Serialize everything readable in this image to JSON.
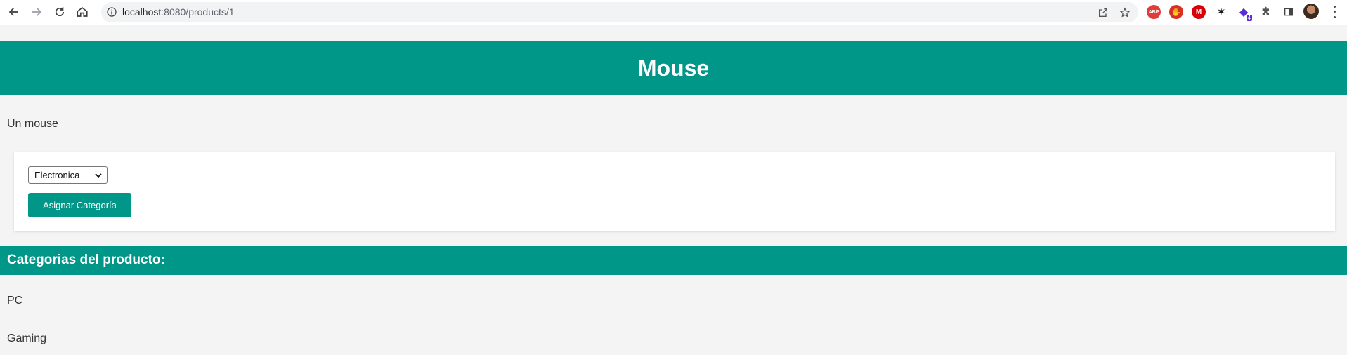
{
  "browser": {
    "url_host": "localhost",
    "url_path": ":8080/products/1",
    "icons": {
      "back": "arrow-left-icon",
      "forward": "arrow-right-icon",
      "reload": "reload-icon",
      "home": "home-icon",
      "site_info": "info-icon",
      "share": "share-icon",
      "bookmark": "star-icon",
      "extensions": [
        "abp-icon",
        "hand-stop-icon",
        "mega-icon",
        "black-extension-icon",
        "purple-extension-icon",
        "puzzle-icon"
      ],
      "side_panel": "side-panel-icon",
      "menu": "more-vertical-icon"
    },
    "abp_label": "ABP",
    "purple_badge": "4"
  },
  "product": {
    "title": "Mouse",
    "description": "Un mouse"
  },
  "assign_form": {
    "selected_category": "Electronica",
    "assign_button_label": "Asignar Categoría"
  },
  "categories_section": {
    "title": "Categorias del producto:",
    "items": [
      "PC",
      "Gaming"
    ]
  },
  "colors": {
    "accent": "#009688",
    "background": "#f4f4f4"
  }
}
